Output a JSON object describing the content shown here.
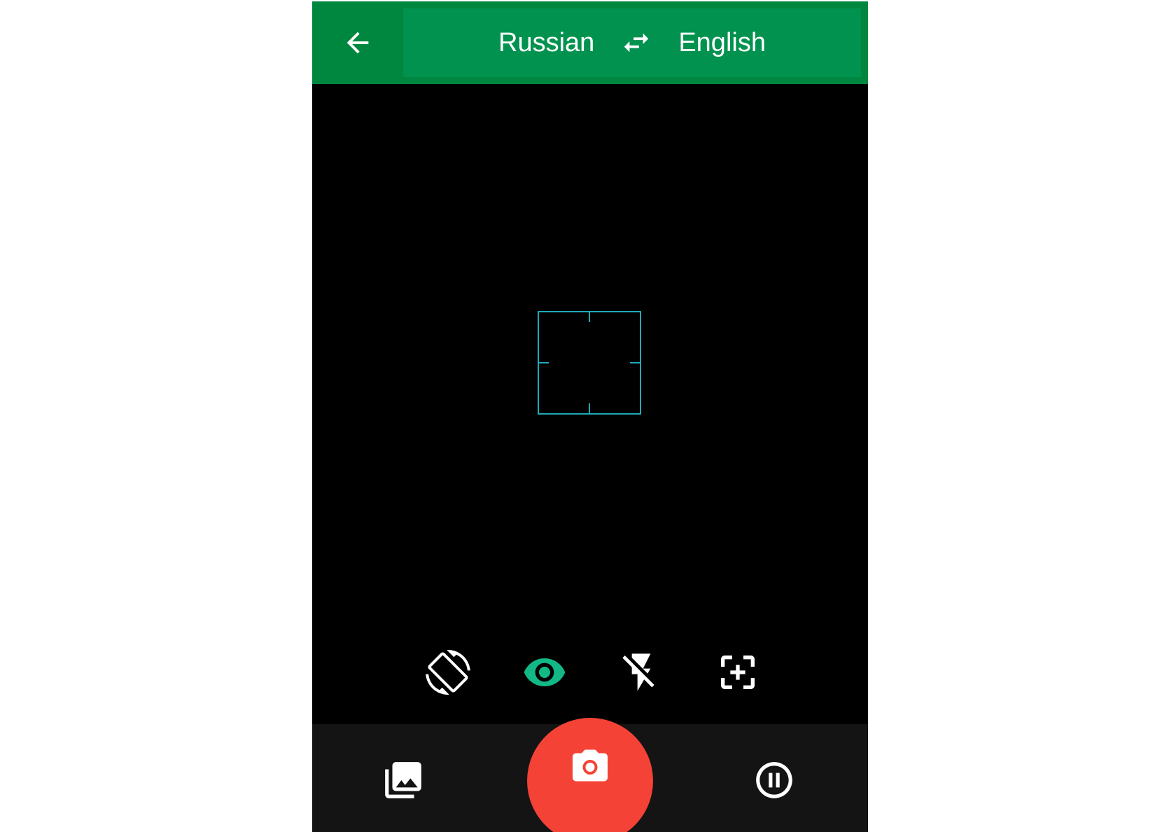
{
  "toolbar": {
    "back_icon": "arrow-back-icon",
    "source_language": "Russian",
    "swap_icon": "swap-horizontal-icon",
    "target_language": "English",
    "background_color": "#00873f",
    "panel_color": "#00924e"
  },
  "viewfinder": {
    "focus_icon": "focus-reticle-icon",
    "focus_color": "#1fa9b8"
  },
  "camera_tools": [
    {
      "name": "rotate-screen",
      "icon": "screen-rotation-icon",
      "active": false
    },
    {
      "name": "preview",
      "icon": "eye-icon",
      "active": true,
      "color": "#12b886"
    },
    {
      "name": "flash",
      "icon": "flash-off-icon",
      "active": false
    },
    {
      "name": "focus-select",
      "icon": "center-focus-icon",
      "active": false
    }
  ],
  "bottom_bar": {
    "gallery_icon": "photo-library-icon",
    "shutter_icon": "camera-icon",
    "shutter_color": "#f44336",
    "pause_icon": "pause-circle-icon"
  }
}
